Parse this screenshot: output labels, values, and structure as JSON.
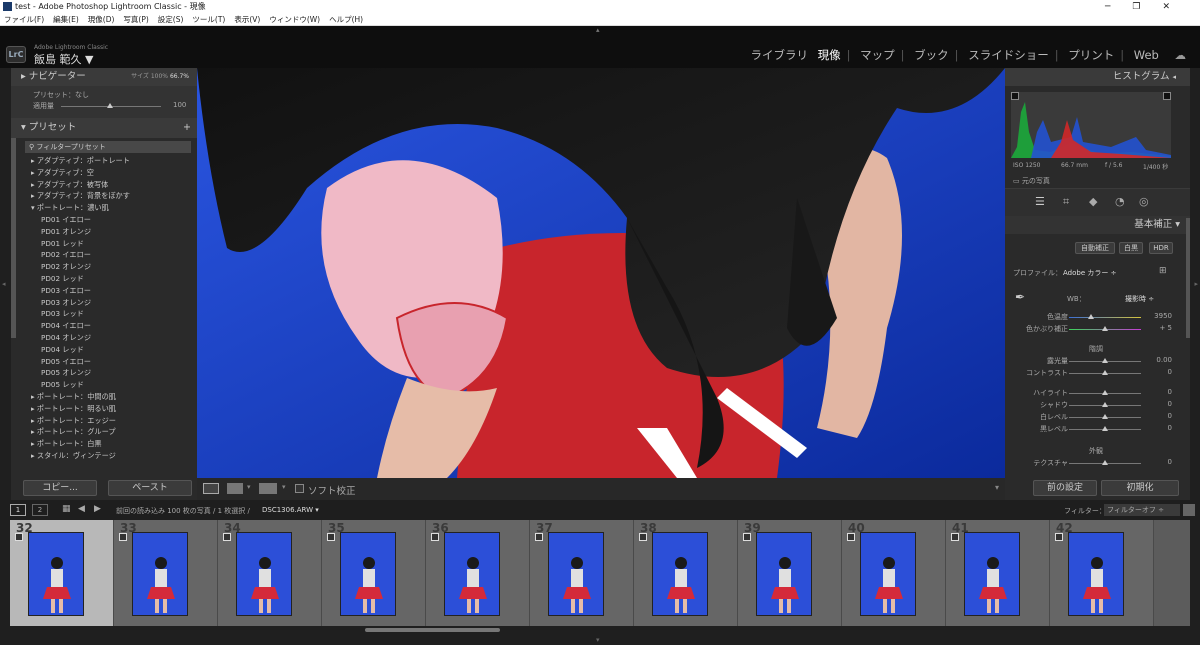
{
  "window": {
    "title": "test - Adobe Photoshop Lightroom Classic - 現像"
  },
  "menu": [
    "ファイル(F)",
    "編集(E)",
    "現像(D)",
    "写真(P)",
    "設定(S)",
    "ツール(T)",
    "表示(V)",
    "ウィンドウ(W)",
    "ヘルプ(H)"
  ],
  "identity": {
    "app": "Adobe Lightroom Classic",
    "user": "飯島 範久 ▼",
    "badge": "LrC"
  },
  "modules": [
    "ライブラリ",
    "現像",
    "マップ",
    "ブック",
    "スライドショー",
    "プリント",
    "Web"
  ],
  "navigator": {
    "title": "ナビゲーター",
    "zoom_options": [
      "サイズ",
      "100%",
      "66.7%"
    ]
  },
  "preset_amount": {
    "preset": "プリセット：なし",
    "amount_label": "適用量",
    "amount_value": "100"
  },
  "presets": {
    "title": "プリセット",
    "filter": "フィルタープリセット",
    "items": [
      {
        "label": "▸ アダプティブ：ポートレート",
        "indent": 0
      },
      {
        "label": "▸ アダプティブ：空",
        "indent": 0
      },
      {
        "label": "▸ アダプティブ：被写体",
        "indent": 0
      },
      {
        "label": "▸ アダプティブ：背景をぼかす",
        "indent": 0
      },
      {
        "label": "▾ ポートレート：濃い肌",
        "indent": 0
      },
      {
        "label": "PD01 イエロー",
        "indent": 1
      },
      {
        "label": "PD01 オレンジ",
        "indent": 1
      },
      {
        "label": "PD01 レッド",
        "indent": 1
      },
      {
        "label": "PD02 イエロー",
        "indent": 1
      },
      {
        "label": "PD02 オレンジ",
        "indent": 1
      },
      {
        "label": "PD02 レッド",
        "indent": 1
      },
      {
        "label": "PD03 イエロー",
        "indent": 1
      },
      {
        "label": "PD03 オレンジ",
        "indent": 1
      },
      {
        "label": "PD03 レッド",
        "indent": 1
      },
      {
        "label": "PD04 イエロー",
        "indent": 1
      },
      {
        "label": "PD04 オレンジ",
        "indent": 1
      },
      {
        "label": "PD04 レッド",
        "indent": 1
      },
      {
        "label": "PD05 イエロー",
        "indent": 1
      },
      {
        "label": "PD05 オレンジ",
        "indent": 1
      },
      {
        "label": "PD05 レッド",
        "indent": 1
      },
      {
        "label": "▸ ポートレート：中間の肌",
        "indent": 0
      },
      {
        "label": "▸ ポートレート：明るい肌",
        "indent": 0
      },
      {
        "label": "▸ ポートレート：エッジー",
        "indent": 0
      },
      {
        "label": "▸ ポートレート：グループ",
        "indent": 0
      },
      {
        "label": "▸ ポートレート：白黒",
        "indent": 0
      },
      {
        "label": "▸ スタイル：ヴィンテージ",
        "indent": 0
      }
    ]
  },
  "left_buttons": {
    "copy": "コピー...",
    "paste": "ペースト"
  },
  "toolbar": {
    "softproof": "ソフト校正"
  },
  "histogram": {
    "title": "ヒストグラム",
    "iso": "ISO 1250",
    "focal": "66.7 mm",
    "aperture": "f / 5.6",
    "shutter": "1/400 秒",
    "original": "元の写真"
  },
  "basic": {
    "title": "基本補正",
    "modes": [
      "自動補正",
      "白黒",
      "HDR"
    ],
    "profile_label": "プロファイル：",
    "profile_value": "Adobe カラー ÷",
    "wb_label": "WB：",
    "wb_value": "撮影時 ÷",
    "sliders": [
      {
        "label": "色温度",
        "value": "3950",
        "pos": 0.3
      },
      {
        "label": "色かぶり補正",
        "value": "+ 5",
        "pos": 0.5
      }
    ],
    "tone_header": "階調",
    "tone": [
      {
        "label": "露光量",
        "value": "0.00",
        "pos": 0.5
      },
      {
        "label": "コントラスト",
        "value": "0",
        "pos": 0.5
      }
    ],
    "tone2": [
      {
        "label": "ハイライト",
        "value": "0",
        "pos": 0.5
      },
      {
        "label": "シャドウ",
        "value": "0",
        "pos": 0.5
      },
      {
        "label": "白レベル",
        "value": "0",
        "pos": 0.5
      },
      {
        "label": "黒レベル",
        "value": "0",
        "pos": 0.5
      }
    ],
    "presence_header": "外観",
    "presence": [
      {
        "label": "テクスチャ",
        "value": "0",
        "pos": 0.5
      }
    ]
  },
  "right_buttons": {
    "previous": "前の設定",
    "reset": "初期化"
  },
  "filmstrip_bar": {
    "pages": [
      "1",
      "2"
    ],
    "source": "前回の読み込み  100 枚の写真 / 1 枚選択 /",
    "filename": "DSC1306.ARW ▾",
    "filter_label": "フィルター：",
    "filter_value": "フィルターオフ ÷"
  },
  "filmstrip": {
    "numbers": [
      "32",
      "33",
      "34",
      "35",
      "36",
      "37",
      "38",
      "39",
      "40",
      "41",
      "42"
    ],
    "selected_index": 0
  }
}
